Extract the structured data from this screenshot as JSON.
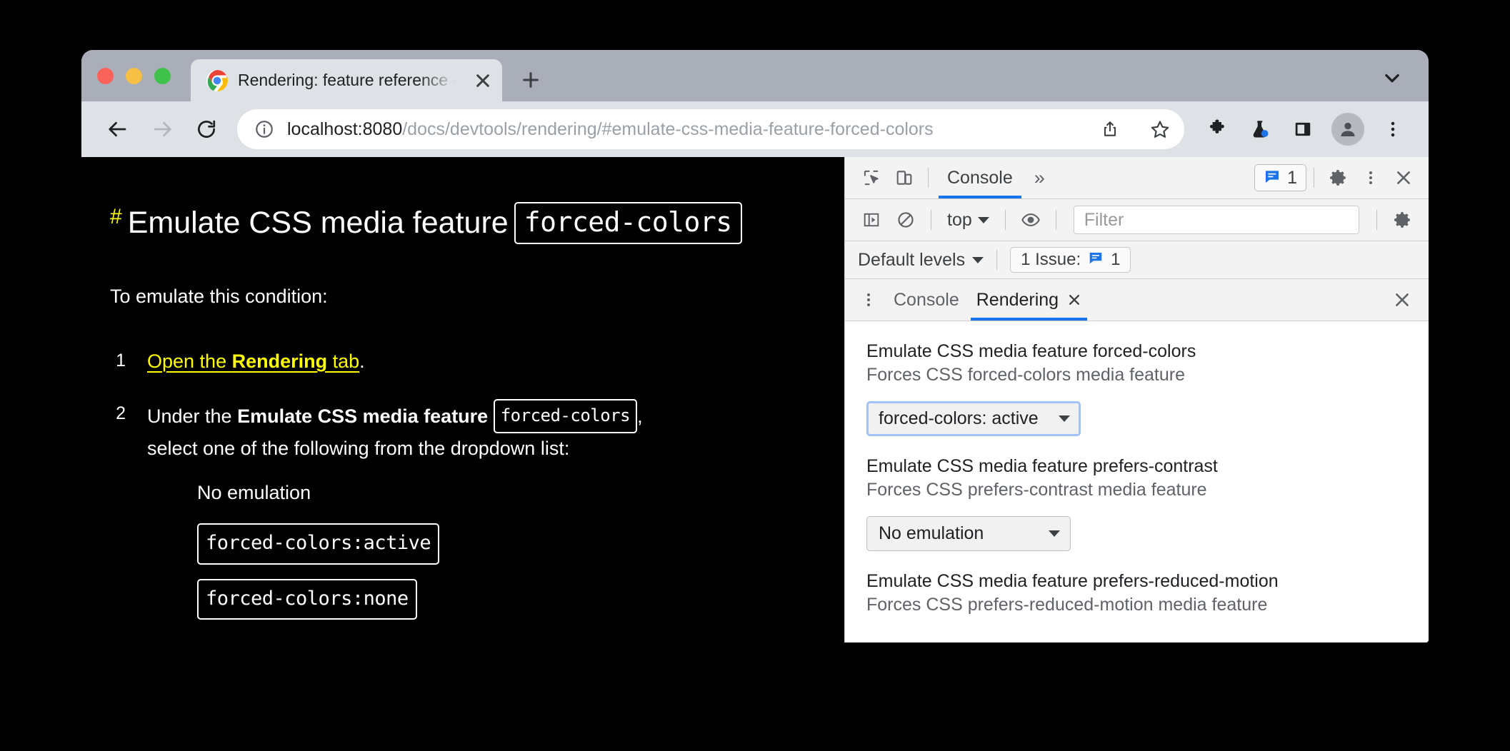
{
  "browser": {
    "tab": {
      "title": "Rendering: feature reference -",
      "favicon": "chrome-logo-icon",
      "close_icon": "close-icon"
    },
    "new_tab_icon": "plus-icon",
    "tab_search_icon": "chevron-down-icon",
    "toolbar": {
      "back_icon": "back-arrow-icon",
      "forward_icon": "forward-arrow-icon",
      "reload_icon": "reload-icon",
      "site_info_icon": "info-circle-icon",
      "url_host": "localhost:8080",
      "url_path": "/docs/devtools/rendering/#emulate-css-media-feature-forced-colors",
      "share_icon": "share-icon",
      "bookmark_icon": "star-icon",
      "extensions_icon": "puzzle-piece-icon",
      "experiments_icon": "flask-icon",
      "side_panel_icon": "side-panel-icon",
      "profile_icon": "person-avatar-icon",
      "menu_icon": "three-dot-menu-icon"
    }
  },
  "page": {
    "heading_anchor": "#",
    "heading_text": "Emulate CSS media feature",
    "heading_code": "forced-colors",
    "intro": "To emulate this condition:",
    "steps": [
      {
        "number": "1",
        "link_prefix": "Open the ",
        "link_bold": "Rendering",
        "link_suffix": " tab",
        "trailing": "."
      },
      {
        "number": "2",
        "prefix": "Under the ",
        "bold": "Emulate CSS media feature",
        "code": "forced-colors",
        "comma": ",",
        "line2": "select one of the following from the dropdown list:"
      }
    ],
    "options": [
      {
        "label": "No emulation",
        "code": false
      },
      {
        "label": "forced-colors:active",
        "code": true
      },
      {
        "label": "forced-colors:none",
        "code": true
      }
    ]
  },
  "devtools": {
    "main_toolbar": {
      "inspect_icon": "inspect-element-icon",
      "device_toolbar_icon": "device-toolbar-icon",
      "panels": [
        {
          "label": "Console",
          "active": true
        }
      ],
      "more_panels": "»",
      "issues_icon": "issues-message-icon",
      "issues_count": "1",
      "settings_icon": "gear-icon",
      "more_options_icon": "three-dot-menu-icon",
      "close_icon": "close-icon"
    },
    "console_toolbar": {
      "sidebar_icon": "console-sidebar-icon",
      "clear_icon": "clear-console-icon",
      "context": "top",
      "eye_icon": "live-expression-eye-icon",
      "filter_placeholder": "Filter",
      "settings_icon": "gear-icon"
    },
    "levels_toolbar": {
      "levels": "Default levels",
      "issues_label": "1 Issue:",
      "issues_icon": "issues-message-icon",
      "issues_count": "1"
    },
    "drawer": {
      "more_icon": "three-dot-menu-icon",
      "tabs": [
        {
          "label": "Console",
          "active": false,
          "closable": false
        },
        {
          "label": "Rendering",
          "active": true,
          "closable": true,
          "close_icon": "close-icon"
        }
      ],
      "close_icon": "close-icon"
    },
    "rendering": {
      "settings": [
        {
          "title": "Emulate CSS media feature forced-colors",
          "description": "Forces CSS forced-colors media feature",
          "select_value": "forced-colors: active",
          "focused": true
        },
        {
          "title": "Emulate CSS media feature prefers-contrast",
          "description": "Forces CSS prefers-contrast media feature",
          "select_value": "No emulation",
          "focused": false
        },
        {
          "title": "Emulate CSS media feature prefers-reduced-motion",
          "description": "Forces CSS prefers-reduced-motion media feature",
          "select_value": null,
          "focused": false
        }
      ]
    }
  },
  "colors": {
    "accent_blue": "#1a73e8",
    "focus_ring": "#a1c2fa",
    "link_yellow": "#ffff00",
    "page_bg": "#000000",
    "chrome_frame": "#a9aeb9",
    "toolbar_bg": "#dee1e6"
  }
}
